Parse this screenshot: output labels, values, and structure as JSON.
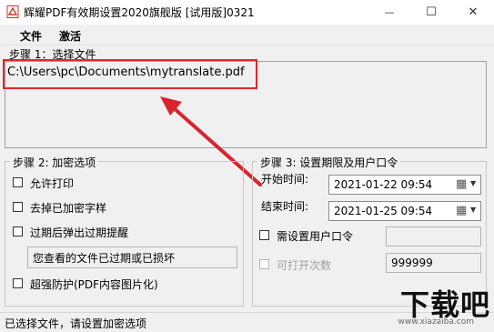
{
  "window": {
    "title": "辉耀PDF有效期设置2020旗舰版 [试用版]0321",
    "minimize_glyph": "—",
    "maximize_glyph": "☐",
    "close_glyph": "✕"
  },
  "menu": {
    "file": "文件",
    "activate": "激活"
  },
  "step1": {
    "label": "步骤 1：选择文件",
    "file_path": "C:\\Users\\pc\\Documents\\mytranslate.pdf"
  },
  "step2": {
    "title": "步骤 2:  加密选项",
    "allow_print": "允许打印",
    "remove_encrypted_font": "去掉已加密字样",
    "expire_popup": "过期后弹出过期提醒",
    "expire_message": "您查看的文件已过期或已损坏",
    "super_protect": "超强防护(PDF内容图片化)"
  },
  "step3": {
    "title": "步骤 3: 设置期限及用户口令",
    "start_label": "开始时间:",
    "start_value": "2021-01-22 09:54",
    "end_label": "结束时间:",
    "end_value": "2021-01-25 09:54",
    "require_password": "需设置用户口令",
    "password_value": "",
    "open_count_label": "可打开次数",
    "open_count_value": "999999"
  },
  "status": {
    "text": "已选择文件，请设置加密选项"
  },
  "watermark": {
    "brand": "下载吧",
    "url": "www.xiazaiba.com"
  },
  "colors": {
    "highlight": "#e3262d",
    "arrow": "#d8242c"
  }
}
